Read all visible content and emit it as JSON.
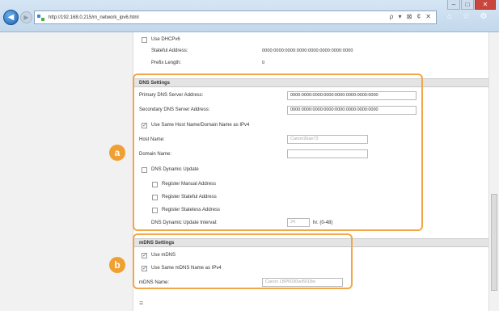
{
  "browser": {
    "url": "http://192.168.0.215/m_network_ipv6.html",
    "addr_tools": "ρ ▾ ⊠ ¢ ✕",
    "chrome_icons": "⌂ ☆ ⚙",
    "window_buttons": {
      "minimize": "–",
      "maximize": "□",
      "close": "✕"
    }
  },
  "ipv6_dhcp": {
    "use_dhcpv6_label": "Use DHCPv6",
    "stateful_address_label": "Stateful Address:",
    "stateful_address_value": "0000:0000:0000:0000:0000:0000:0000:0000",
    "prefix_length_label": "Prefix Length:",
    "prefix_length_value": "0"
  },
  "dns_settings": {
    "title": "DNS Settings",
    "primary_label": "Primary DNS Server Address:",
    "primary_value": "0000:0000:0000:0000:0000:0000:0000:0000",
    "secondary_label": "Secondary DNS Server Address:",
    "secondary_value": "0000:0000:0000:0000:0000:0000:0000:0000",
    "use_same_host_label": "Use Same Host Name/Domain Name as IPv4",
    "use_same_host_checked": true,
    "host_name_label": "Host Name:",
    "host_name_value": "Canon2bae73",
    "domain_name_label": "Domain Name:",
    "domain_name_value": "",
    "dynamic_update_label": "DNS Dynamic Update",
    "register_manual_label": "Register Manual Address",
    "register_stateful_label": "Register Stateful Address",
    "register_stateless_label": "Register Stateless Address",
    "interval_label": "DNS Dynamic Update Interval:",
    "interval_value": "24",
    "interval_unit": "hr. (0-48)"
  },
  "mdns_settings": {
    "title": "mDNS Settings",
    "use_mdns_label": "Use mDNS",
    "use_mdns_checked": true,
    "use_same_mdns_label": "Use Same mDNS Name as IPv4",
    "use_same_mdns_checked": true,
    "mdns_name_label": "mDNS Name:",
    "mdns_name_value": "Canon LBP6030w/6018w"
  },
  "callouts": {
    "a": "a",
    "b": "b"
  },
  "footer_mark": "≡",
  "colors": {
    "callout": "#f0a032",
    "frame": "#f2a64a",
    "section_header": "#e4e4e4"
  }
}
